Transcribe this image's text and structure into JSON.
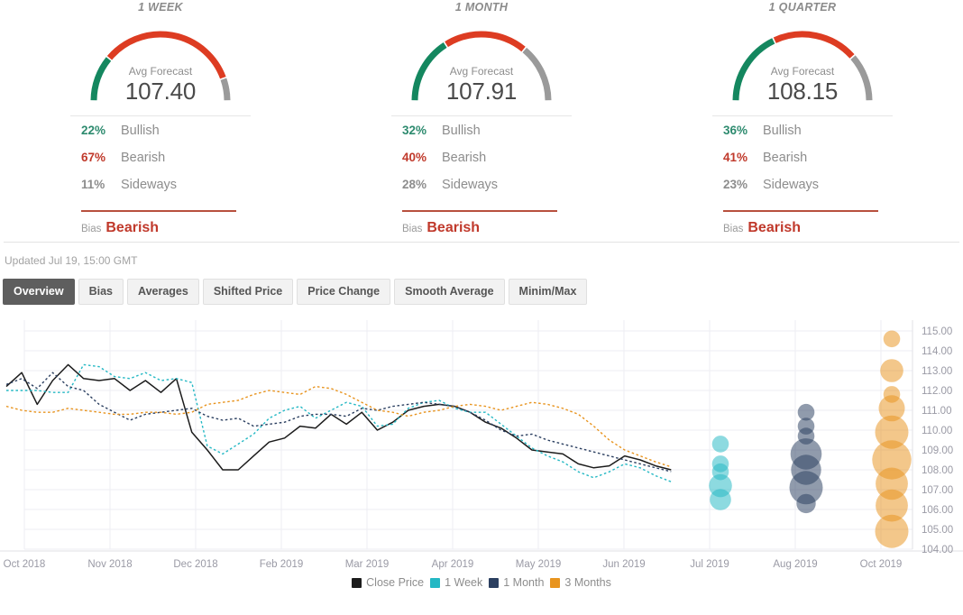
{
  "cards": [
    {
      "title": "1 WEEK",
      "caption": "Avg Forecast",
      "value": "107.40",
      "bullish_pct": "22%",
      "bullish_label": "Bullish",
      "bearish_pct": "67%",
      "bearish_label": "Bearish",
      "sideways_pct": "11%",
      "sideways_label": "Sideways",
      "bias_label": "Bias",
      "bias_value": "Bearish",
      "gauge": {
        "green": 22,
        "red": 67,
        "gray": 11
      }
    },
    {
      "title": "1 MONTH",
      "caption": "Avg Forecast",
      "value": "107.91",
      "bullish_pct": "32%",
      "bullish_label": "Bullish",
      "bearish_pct": "40%",
      "bearish_label": "Bearish",
      "sideways_pct": "28%",
      "sideways_label": "Sideways",
      "bias_label": "Bias",
      "bias_value": "Bearish",
      "gauge": {
        "green": 32,
        "red": 40,
        "gray": 28
      }
    },
    {
      "title": "1 QUARTER",
      "caption": "Avg Forecast",
      "value": "108.15",
      "bullish_pct": "36%",
      "bullish_label": "Bullish",
      "bearish_pct": "41%",
      "bearish_label": "Bearish",
      "sideways_pct": "23%",
      "sideways_label": "Sideways",
      "bias_label": "Bias",
      "bias_value": "Bearish",
      "gauge": {
        "green": 36,
        "red": 41,
        "gray": 23
      }
    }
  ],
  "updated": "Updated Jul 19, 15:00 GMT",
  "tabs": [
    {
      "label": "Overview",
      "active": true
    },
    {
      "label": "Bias",
      "active": false
    },
    {
      "label": "Averages",
      "active": false
    },
    {
      "label": "Shifted Price",
      "active": false
    },
    {
      "label": "Price Change",
      "active": false
    },
    {
      "label": "Smooth Average",
      "active": false
    },
    {
      "label": "Minim/Max",
      "active": false
    }
  ],
  "colors": {
    "bullish": "#2e8b6f",
    "bearish": "#c0392b",
    "sideways": "#9b9b9b",
    "gauge_green": "#14875f",
    "gauge_red": "#dd3c22",
    "gauge_gray": "#9a9a9a",
    "close_price": "#1c1c1c",
    "one_week": "#24b8c4",
    "one_month": "#2b3f60",
    "three_months": "#e8941f",
    "tab_active_bg": "#5e5e5e",
    "tab_bg": "#f2f2f2"
  },
  "chart_data": {
    "type": "line",
    "title": "",
    "xlabel": "",
    "ylabel": "",
    "ylim": [
      104.0,
      115.0
    ],
    "grid": true,
    "legend_position": "bottom",
    "ytick_labels": [
      "115.00",
      "114.00",
      "113.00",
      "112.00",
      "111.00",
      "110.00",
      "109.00",
      "108.00",
      "107.00",
      "106.00",
      "105.00",
      "104.00"
    ],
    "ytick_values": [
      115,
      114,
      113,
      112,
      111,
      110,
      109,
      108,
      107,
      106,
      105,
      104
    ],
    "xtick_labels": [
      "Oct 2018",
      "Nov 2018",
      "Dec 2018",
      "Feb 2019",
      "Mar 2019",
      "Apr 2019",
      "May 2019",
      "Jun 2019",
      "Jul 2019",
      "Aug 2019",
      "Oct 2019"
    ],
    "legend": [
      {
        "name": "Close Price",
        "color": "#1c1c1c",
        "style": "solid"
      },
      {
        "name": "1 Week",
        "color": "#24b8c4",
        "style": "dotted"
      },
      {
        "name": "1 Month",
        "color": "#2b3f60",
        "style": "dotted"
      },
      {
        "name": "3 Months",
        "color": "#e8941f",
        "style": "dotted"
      }
    ],
    "series": [
      {
        "name": "Close Price",
        "color": "#1c1c1c",
        "style": "solid",
        "values": [
          112.2,
          112.9,
          111.3,
          112.5,
          113.3,
          112.6,
          112.5,
          112.6,
          112.0,
          112.5,
          111.9,
          112.6,
          109.9,
          109.0,
          108.0,
          108.0,
          108.7,
          109.4,
          109.6,
          110.2,
          110.1,
          110.8,
          110.3,
          110.9,
          110.0,
          110.4,
          111.0,
          111.2,
          111.3,
          111.2,
          110.9,
          110.4,
          110.1,
          109.6,
          109.0,
          108.9,
          108.8,
          108.3,
          108.1,
          108.2,
          108.7,
          108.5,
          108.2,
          108.0
        ]
      },
      {
        "name": "1 Week",
        "color": "#24b8c4",
        "style": "dotted",
        "values": [
          112.0,
          112.0,
          112.0,
          111.9,
          111.9,
          113.3,
          113.2,
          112.7,
          112.6,
          112.9,
          112.5,
          112.6,
          112.4,
          109.2,
          108.8,
          109.3,
          109.8,
          110.6,
          111.0,
          111.2,
          110.6,
          111.0,
          111.4,
          111.2,
          110.2,
          110.3,
          111.1,
          111.4,
          111.5,
          111.1,
          110.9,
          110.9,
          110.3,
          109.7,
          109.1,
          108.7,
          108.4,
          107.9,
          107.6,
          107.9,
          108.3,
          108.1,
          107.7,
          107.4
        ]
      },
      {
        "name": "1 Month",
        "color": "#2b3f60",
        "style": "dotted",
        "values": [
          112.3,
          112.6,
          112.1,
          112.9,
          112.2,
          112.0,
          111.3,
          110.9,
          110.5,
          110.8,
          110.9,
          111.0,
          111.1,
          110.7,
          110.5,
          110.6,
          110.2,
          110.3,
          110.4,
          110.7,
          110.8,
          110.8,
          110.7,
          111.1,
          111.0,
          111.2,
          111.3,
          111.4,
          111.3,
          111.2,
          110.9,
          110.5,
          110.0,
          109.7,
          109.8,
          109.5,
          109.3,
          109.1,
          108.9,
          108.7,
          108.5,
          108.3,
          108.1,
          107.91
        ]
      },
      {
        "name": "3 Months",
        "color": "#e8941f",
        "style": "dotted",
        "values": [
          111.2,
          111.0,
          110.9,
          110.9,
          111.1,
          111.0,
          110.9,
          110.8,
          110.8,
          110.9,
          110.9,
          110.8,
          110.9,
          111.3,
          111.4,
          111.5,
          111.8,
          112.0,
          111.9,
          111.8,
          112.2,
          112.1,
          111.8,
          111.4,
          111.0,
          110.9,
          110.7,
          110.9,
          111.0,
          111.2,
          111.3,
          111.2,
          111.0,
          111.2,
          111.4,
          111.3,
          111.1,
          110.8,
          110.2,
          109.5,
          109.0,
          108.7,
          108.4,
          108.15
        ]
      }
    ],
    "bubble_clusters": [
      {
        "name": "1 Week",
        "color": "#24b8c4",
        "x_label": "Jul 2019",
        "points": [
          {
            "value": 109.3,
            "weight": 2
          },
          {
            "value": 108.3,
            "weight": 2
          },
          {
            "value": 107.9,
            "weight": 2
          },
          {
            "value": 107.2,
            "weight": 5
          },
          {
            "value": 106.5,
            "weight": 4
          }
        ]
      },
      {
        "name": "1 Month",
        "color": "#2b3f60",
        "x_label": "Aug 2019",
        "points": [
          {
            "value": 110.9,
            "weight": 2
          },
          {
            "value": 110.2,
            "weight": 2
          },
          {
            "value": 109.7,
            "weight": 2
          },
          {
            "value": 108.8,
            "weight": 11
          },
          {
            "value": 108.0,
            "weight": 10
          },
          {
            "value": 107.1,
            "weight": 13
          },
          {
            "value": 106.3,
            "weight": 3
          }
        ]
      },
      {
        "name": "3 Months",
        "color": "#e8941f",
        "x_label": "Oct 2019",
        "points": [
          {
            "value": 114.6,
            "weight": 2
          },
          {
            "value": 113.0,
            "weight": 5
          },
          {
            "value": 111.8,
            "weight": 2
          },
          {
            "value": 111.1,
            "weight": 7
          },
          {
            "value": 109.9,
            "weight": 13
          },
          {
            "value": 108.5,
            "weight": 19
          },
          {
            "value": 107.3,
            "weight": 12
          },
          {
            "value": 106.2,
            "weight": 12
          },
          {
            "value": 104.9,
            "weight": 13
          }
        ]
      }
    ]
  }
}
